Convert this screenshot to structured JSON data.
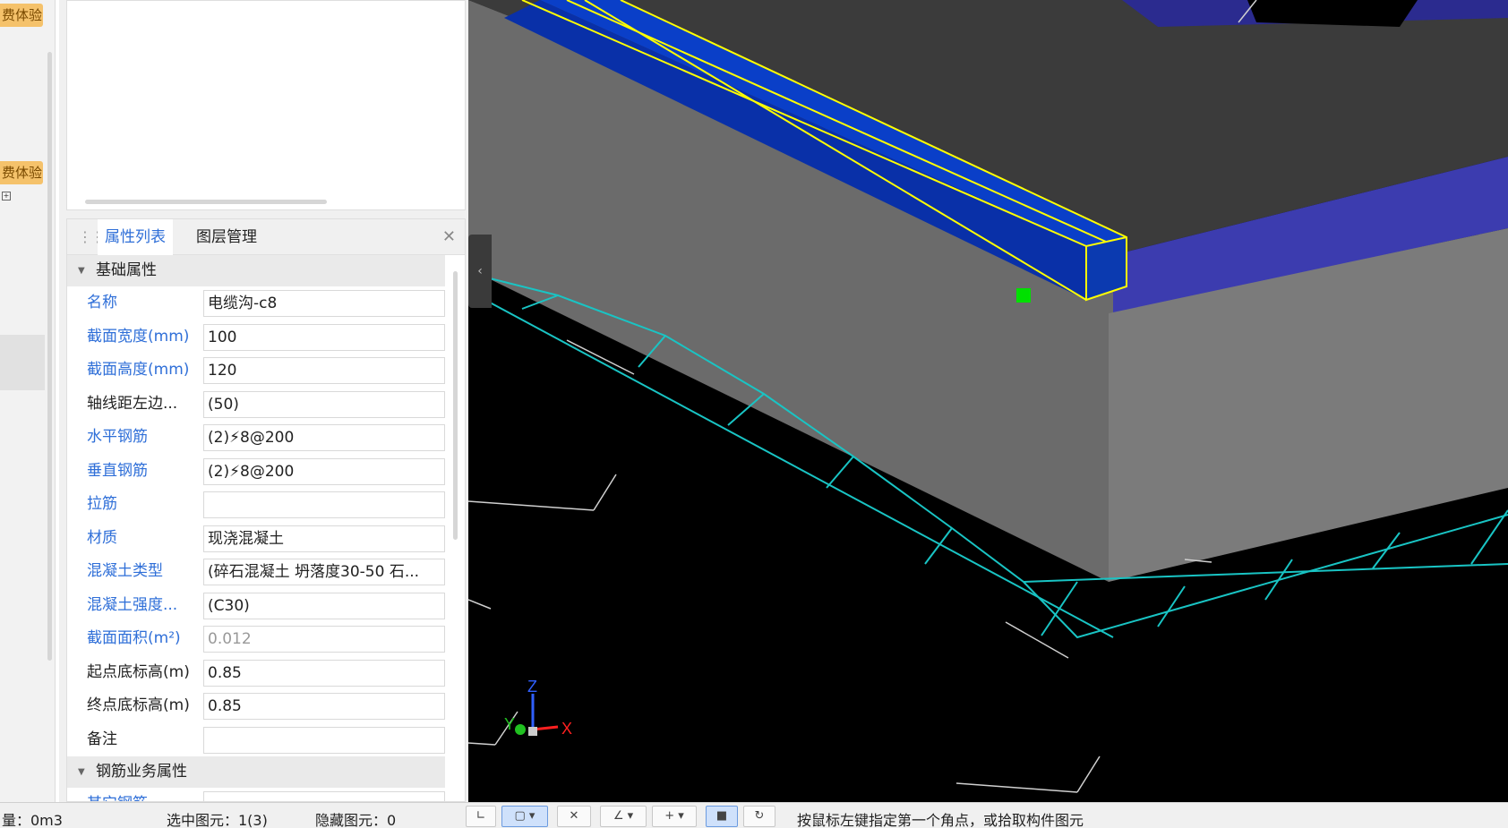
{
  "left_strip": {
    "badges": [
      "费体验",
      "费体验"
    ]
  },
  "property_panel": {
    "tabs": [
      "属性列表",
      "图层管理"
    ],
    "basic_group_label": "基础属性",
    "rows": [
      {
        "label": "名称",
        "value": "电缆沟-c8"
      },
      {
        "label": "截面宽度(mm)",
        "value": "100"
      },
      {
        "label": "截面高度(mm)",
        "value": "120"
      },
      {
        "label": "轴线距左边...",
        "value": "(50)"
      },
      {
        "label": "水平钢筋",
        "value": "(2)⚡8@200"
      },
      {
        "label": "垂直钢筋",
        "value": "(2)⚡8@200"
      },
      {
        "label": "拉筋",
        "value": ""
      },
      {
        "label": "材质",
        "value": "现浇混凝土"
      },
      {
        "label": "混凝土类型",
        "value": "(碎石混凝土 坍落度30-50 石..."
      },
      {
        "label": "混凝土强度...",
        "value": "(C30)"
      },
      {
        "label": "截面面积(m²)",
        "value": "0.012"
      },
      {
        "label": "起点底标高(m)",
        "value": "0.85"
      },
      {
        "label": "终点底标高(m)",
        "value": "0.85"
      },
      {
        "label": "备注",
        "value": ""
      }
    ],
    "rebar_group_label": "钢筋业务属性",
    "partial_row_label": "其它钢筋"
  },
  "axes": {
    "x": "X",
    "y": "Y",
    "z": "Z"
  },
  "status_bar": {
    "left_text": "量：0m3",
    "selected_text": "选中图元：1(3)",
    "hidden_text": "隐藏图元：0",
    "hint_text": "按鼠标左键指定第一个角点，或拾取构件图元"
  },
  "colors": {
    "accent_blue": "#2f6fd8",
    "badge_orange": "#f5c26b",
    "selection_yellow": "#ffff00",
    "grid_cyan": "#19c4c4",
    "beam_blue": "#0a3fc8",
    "slab_gray": "#6b6b6b"
  }
}
